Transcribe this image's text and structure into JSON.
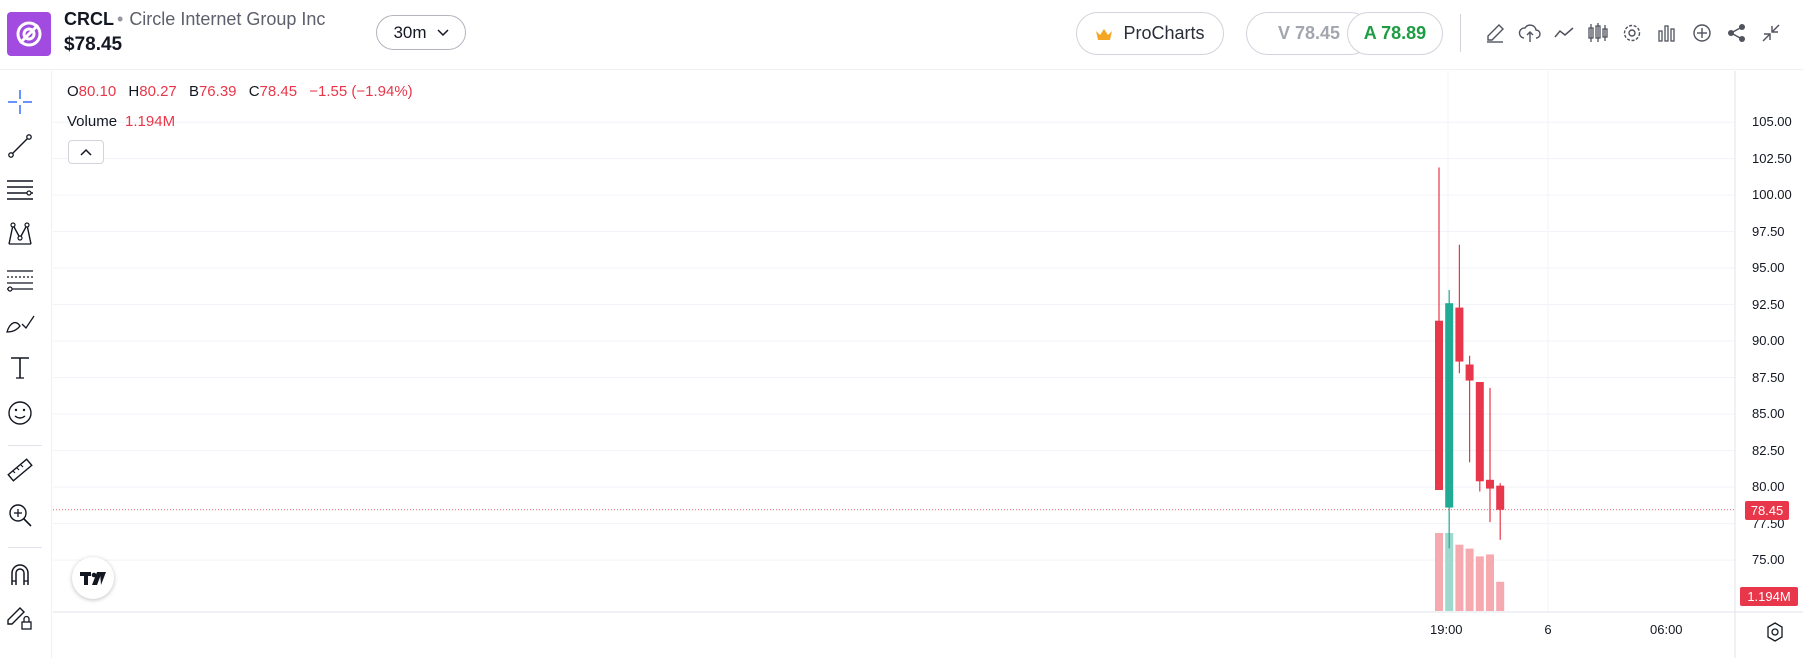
{
  "header": {
    "ticker": "CRCL",
    "company": "Circle Internet Group Inc",
    "price": "$78.45",
    "interval": "30m",
    "procharts_label": "ProCharts",
    "bid": "V 78.45",
    "ask": "A 78.89"
  },
  "legend": {
    "o_key": "O",
    "o_val": "80.10",
    "h_key": "H",
    "h_val": "80.27",
    "l_key": "B",
    "l_val": "76.39",
    "c_key": "C",
    "c_val": "78.45",
    "change": "−1.55 (−1.94%)",
    "volume_label": "Volume",
    "volume_value": "1.194M"
  },
  "axis": {
    "price_ticks": [
      "105.00",
      "102.50",
      "100.00",
      "97.50",
      "95.00",
      "92.50",
      "90.00",
      "87.50",
      "85.00",
      "82.50",
      "80.00",
      "77.50",
      "75.00"
    ],
    "time_ticks": [
      "19:00",
      "6",
      "06:00"
    ],
    "last_price_tag": "78.45",
    "volume_tag": "1.194M"
  },
  "colors": {
    "up": "#22ab94",
    "down": "#e8374a",
    "volume_down": "#f7a9b0",
    "volume_up": "#9fd8cc",
    "brand": "#a24be0"
  },
  "chart_data": {
    "type": "candlestick",
    "ylim": [
      73.5,
      107.0
    ],
    "last_price": 78.45,
    "candles": [
      {
        "o": 91.4,
        "h": 101.9,
        "l": 80.4,
        "c": 79.8,
        "vol": 0.4
      },
      {
        "o": 78.6,
        "h": 93.5,
        "l": 75.8,
        "c": 92.6,
        "vol": 0.4
      },
      {
        "o": 92.3,
        "h": 96.6,
        "l": 87.8,
        "c": 88.6,
        "vol": 0.34
      },
      {
        "o": 88.4,
        "h": 89.0,
        "l": 81.7,
        "c": 87.3,
        "vol": 0.32
      },
      {
        "o": 87.2,
        "h": 87.2,
        "l": 79.7,
        "c": 80.4,
        "vol": 0.28
      },
      {
        "o": 80.5,
        "h": 86.8,
        "l": 77.6,
        "c": 79.9,
        "vol": 0.29
      },
      {
        "o": 80.1,
        "h": 80.27,
        "l": 76.39,
        "c": 78.45,
        "vol": 0.15
      }
    ]
  },
  "icons": {
    "toolbar": [
      "pencil-icon",
      "cloud-icon",
      "line-chart-icon",
      "candles-icon",
      "gear-icon",
      "bar-chart-icon",
      "plus-circle-icon",
      "share-icon",
      "collapse-icon"
    ],
    "left": [
      "crosshair-icon",
      "trend-line-icon",
      "horizontal-lines-icon",
      "pattern-icon",
      "fib-icon",
      "brush-icon",
      "text-icon",
      "emoji-icon",
      "ruler-icon",
      "zoom-icon",
      "magnet-icon",
      "lock-draw-icon"
    ]
  }
}
